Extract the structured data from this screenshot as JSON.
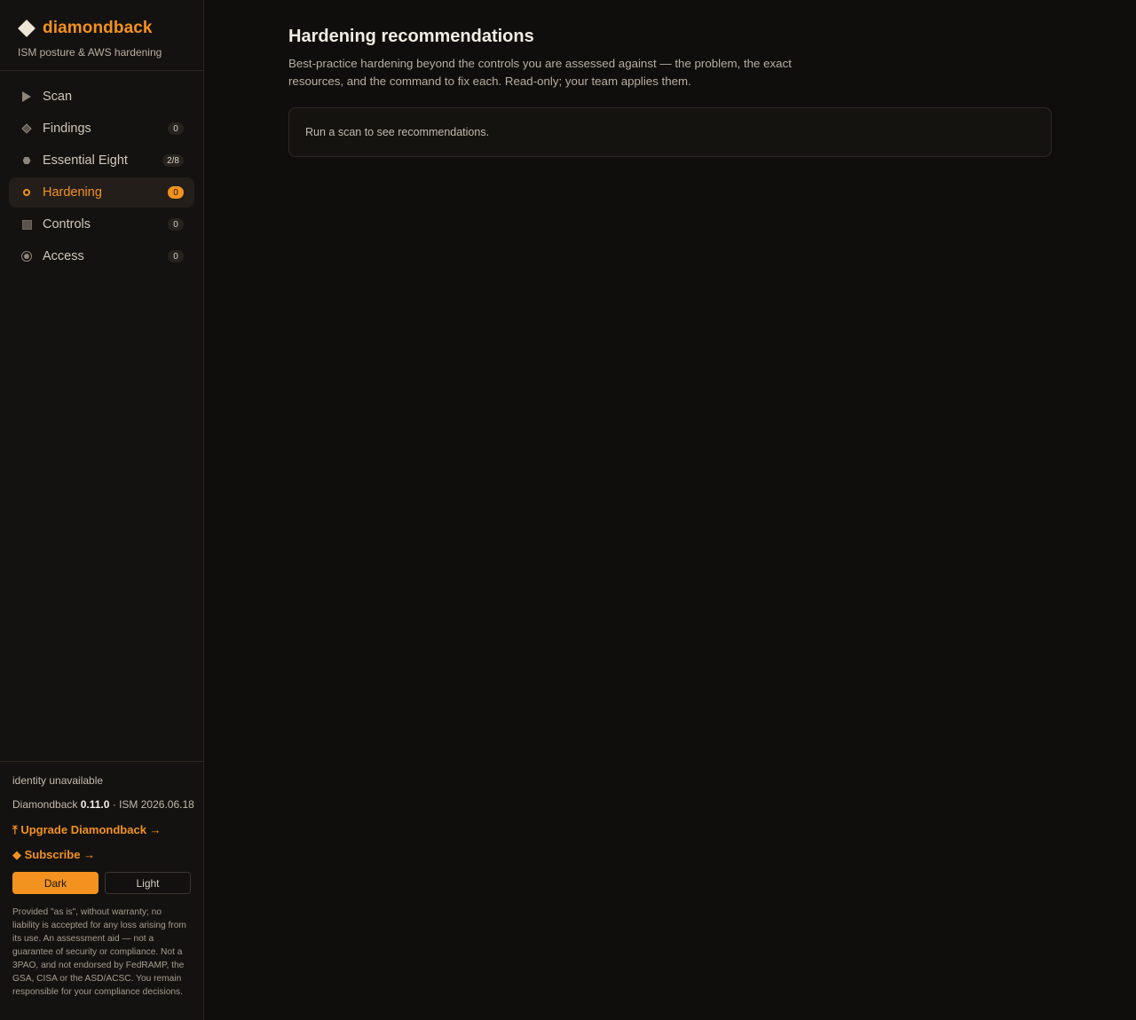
{
  "brand": {
    "name": "diamondback",
    "tagline": "ISM posture & AWS hardening",
    "logo_icon": "diamond-icon"
  },
  "nav": {
    "items": [
      {
        "label": "Scan",
        "icon": "play-icon",
        "badge": "",
        "active": false
      },
      {
        "label": "Findings",
        "icon": "diamond-icon",
        "badge": "0",
        "active": false
      },
      {
        "label": "Essential Eight",
        "icon": "hexagon-icon",
        "badge": "2/8",
        "active": false
      },
      {
        "label": "Hardening",
        "icon": "gear-icon",
        "badge": "0",
        "active": true
      },
      {
        "label": "Controls",
        "icon": "square-icon",
        "badge": "0",
        "active": false
      },
      {
        "label": "Access",
        "icon": "circle-icon",
        "badge": "0",
        "active": false
      }
    ]
  },
  "footer": {
    "identity": "identity unavailable",
    "version_prefix": "Diamondback ",
    "version_number": "0.11.0",
    "version_suffix": " · ISM 2026.06.18",
    "upgrade_label": "⤒ Upgrade Diamondback →",
    "subscribe_label": "◆ Subscribe →",
    "theme_dark": "Dark",
    "theme_light": "Light",
    "theme_selected": "Dark",
    "disclaimer": "Provided \"as is\", without warranty; no liability is accepted for any loss arising from its use. An assessment aid — not a guarantee of security or compliance. Not a 3PAO, and not endorsed by FedRAMP, the GSA, CISA or the ASD/ACSC. You remain responsible for your compliance decisions."
  },
  "main": {
    "title": "Hardening recommendations",
    "description": "Best-practice hardening beyond the controls you are assessed against — the problem, the exact resources, and the command to fix each. Read-only; your team applies them.",
    "empty_message": "Run a scan to see recommendations."
  },
  "colors": {
    "accent": "#f3921f",
    "background": "#0f0e0d",
    "sidebar": "#141210"
  }
}
